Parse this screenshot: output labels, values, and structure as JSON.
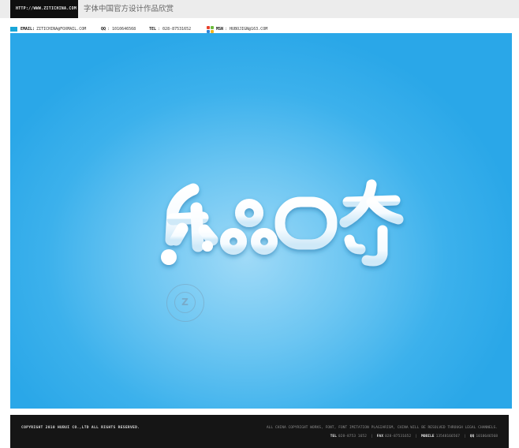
{
  "header": {
    "url": "HTTP://WWW.ZITICHINA.COM",
    "site_title": "字体中国官方设计作品欣赏"
  },
  "contact": {
    "email_label": "EMAIL:",
    "email_value": "ZITICHINA@FOXMAIL.COM",
    "qq_label": "QQ",
    "qq_value": ": 1010646568",
    "tel_label": "TEL",
    "tel_value": ": 028-87531652",
    "msn_label": "MSN",
    "msn_value": ": HUBOJIGN@163.COM"
  },
  "artwork": {
    "wordmark": "乐品曲奇",
    "watermark_letter": "Z"
  },
  "footer": {
    "copyright": "COPYRIGHT 2010 HUBUI CO.,LTD ALL RIGHTS RESERVED.",
    "legal": "ALL CHINA COPYRIGHT WORKS, FONT, FONT IMITATION PLAGIARISM, CHINA WILL BE RESOLVED THROUGH LEGAL CHANNELS.",
    "tel_label": "TEL",
    "tel_value": "028-8753 1652",
    "fax_label": "FAX",
    "fax_value": "028-87531652",
    "mobile_label": "MOBILE",
    "mobile_value": "13548166567",
    "qq_label": "QQ",
    "qq_value": "1010646568",
    "separator": "|"
  },
  "colors": {
    "panel_blue": "#2aa7e8",
    "panel_center": "#9fdaf7",
    "badge_black": "#0f0f0f",
    "mail_icon": "#19a6d8"
  }
}
